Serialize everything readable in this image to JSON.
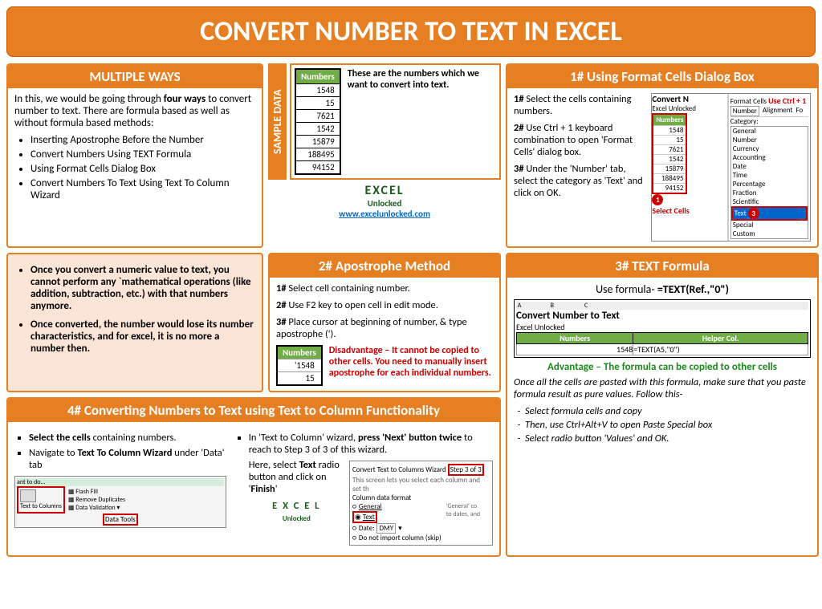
{
  "title": "CONVERT NUMBER TO TEXT IN EXCEL",
  "multiple_ways": {
    "header": "MULTIPLE WAYS",
    "intro1": "In this, we would be going through ",
    "intro_bold": "four ways",
    "intro2": " to convert number to text. There are formula based as well as without formula based methods:",
    "items": [
      "Inserting Apostrophe Before the Number",
      "Convert Numbers Using TEXT Formula",
      "Using Format Cells Dialog Box",
      "Convert Numbers To Text Using Text To Column Wizard"
    ]
  },
  "sample": {
    "label": "SAMPLE DATA",
    "col_header": "Numbers",
    "values": [
      "1548",
      "15",
      "7621",
      "1542",
      "15879",
      "188495",
      "94152"
    ],
    "caption": "These are the numbers which we want to convert into text.",
    "logo_text": "EXCEL",
    "logo_sub": "Unlocked",
    "url": "www.excelunlocked.com"
  },
  "format_cells": {
    "header": "1# Using Format Cells Dialog Box",
    "s1b": "1#",
    "s1": " Select the cells containing numbers.",
    "s2b": "2#",
    "s2": " Use Ctrl + 1 keyboard combination to open 'Format Cells' dialog box.",
    "s3b": "3#",
    "s3": " Under the 'Number' tab, select the category as 'Text' and click on OK.",
    "img_title": "Convert N",
    "img_sub": "Excel Unlocked",
    "col_header": "Numbers",
    "vals": [
      "1548",
      "15",
      "7621",
      "1542",
      "15879",
      "188495",
      "94152"
    ],
    "select_label": "Select Cells",
    "panel_title": "Format Cells",
    "shortcut": "Use Ctrl + 1",
    "tab1": "Number",
    "tab2": "Alignment",
    "tab3": "Fo",
    "cat_label": "Category:",
    "cats": [
      "General",
      "Number",
      "Currency",
      "Accounting",
      "Date",
      "Time",
      "Percentage",
      "Fraction",
      "Scientific",
      "Text",
      "Special",
      "Custom"
    ],
    "b1": "1",
    "b3": "3"
  },
  "notes": {
    "n1": "Once you convert a numeric value to text, you cannot perform any `mathematical operations (like addition, subtraction, etc.) with that numbers anymore.",
    "n2": "Once converted, the number would lose its number characteristics, and for excel, it is no more a number then."
  },
  "apostrophe": {
    "header": "2# Apostrophe Method",
    "s1b": "1#",
    "s1": " Select cell containing number.",
    "s2b": "2#",
    "s2": " Use F2 key to open cell in edit mode.",
    "s3b": "3#",
    "s3": " Place cursor at beginning of number, & type apostrophe (').",
    "col": "Numbers",
    "v1": "'1548",
    "v2": "15",
    "disadv": "Disadvantage – It cannot be copied to other cells. You need to manually insert apostrophe for each individual numbers."
  },
  "text_formula": {
    "header": "3# TEXT Formula",
    "use": "Use formula-  ",
    "formula": "=TEXT(Ref.,\"0\")",
    "img_title": "Convert Number to Text",
    "img_sub": "Excel Unlocked",
    "h1": "Numbers",
    "h2": "Helper Col.",
    "v1": "1548",
    "v2": "=TEXT(A5,\"0\")",
    "advantage": "Advantage – The formula can be copied to other cells",
    "note": "Once all the cells are pasted with this formula, make sure that you paste formula result as pure values. Follow this-",
    "steps": [
      "Select formula cells and copy",
      "Then, use Ctrl+Alt+V to open Paste Special box",
      "Select radio button 'Values' and OK."
    ]
  },
  "method4": {
    "header": "4# Converting Numbers to Text using Text to Column Functionality",
    "l1a": "Select the cells ",
    "l1b": "containing numbers.",
    "l2a": "Navigate to ",
    "l2b": "Text To Column Wizard ",
    "l2c": "under 'Data' tab",
    "r1a": "In 'Text to Column' wizard, ",
    "r1b": "press 'Next' button twice ",
    "r1c": "to reach to Step 3 of 3 of this wizard.",
    "r2a": "Here, select ",
    "r2b": "Text ",
    "r2c": "radio button and click on '",
    "r2d": "Finish",
    "r2e": "'",
    "ribbon_title": "ant to do...",
    "ribbon_items": [
      "Flash Fill",
      "Remove Duplicates",
      "Data Validation"
    ],
    "ribbon_main": "Text to Columns",
    "ribbon_group": "Data Tools",
    "wiz_title": "Convert Text to Columns Wizard",
    "wiz_step": "Step 3 of 3",
    "wiz_desc": "This screen lets you select each column and set th",
    "wiz_label": "Column data format",
    "wiz_o1": "General",
    "wiz_o2": "Text",
    "wiz_o3": "Date:",
    "wiz_o4": "Do not import column (skip)",
    "wiz_dmy": "DMY",
    "wiz_side": "'General' co\nto dates, and"
  }
}
